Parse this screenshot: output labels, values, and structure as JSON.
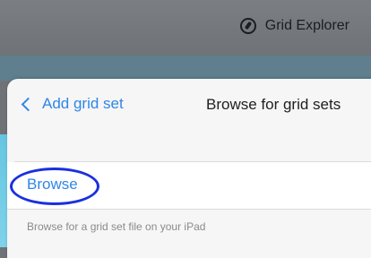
{
  "app": {
    "title": "Grid Explorer",
    "title_icon": "compass-icon"
  },
  "sheet": {
    "back_label": "Add grid set",
    "title": "Browse for grid sets",
    "browse_label": "Browse",
    "footer_text": "Browse for a grid set file on your iPad"
  },
  "colors": {
    "accent": "#2f86e8",
    "highlight_ring": "#1930e0",
    "backdrop": "#6f7377"
  }
}
